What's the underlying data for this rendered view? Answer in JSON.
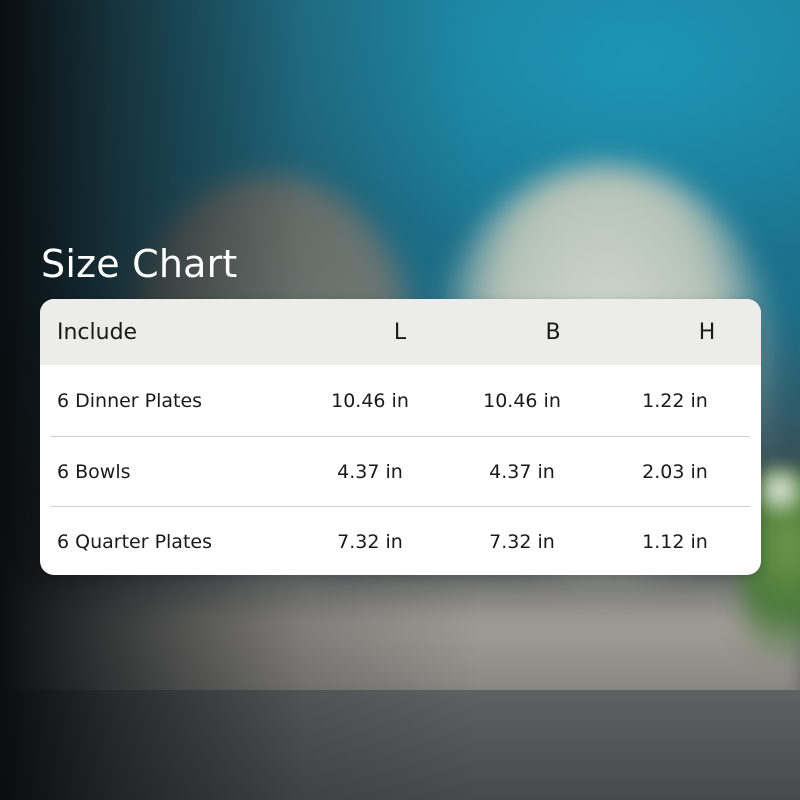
{
  "title": "Size Chart",
  "table": {
    "headers": [
      "Include",
      "L",
      "B",
      "H"
    ],
    "rows": [
      [
        "6 Dinner Plates",
        "10.46 in",
        "10.46 in",
        "1.22 in"
      ],
      [
        "6 Bowls",
        "4.37 in",
        "4.37 in",
        "2.03 in"
      ],
      [
        "6 Quarter Plates",
        "7.32 in",
        "7.32 in",
        "1.12 in"
      ]
    ]
  },
  "colors": {
    "header_bg": "#ececea",
    "card_bg": "#ffffff",
    "title_text": "#ffffff",
    "cell_text": "#1a1a1a"
  }
}
